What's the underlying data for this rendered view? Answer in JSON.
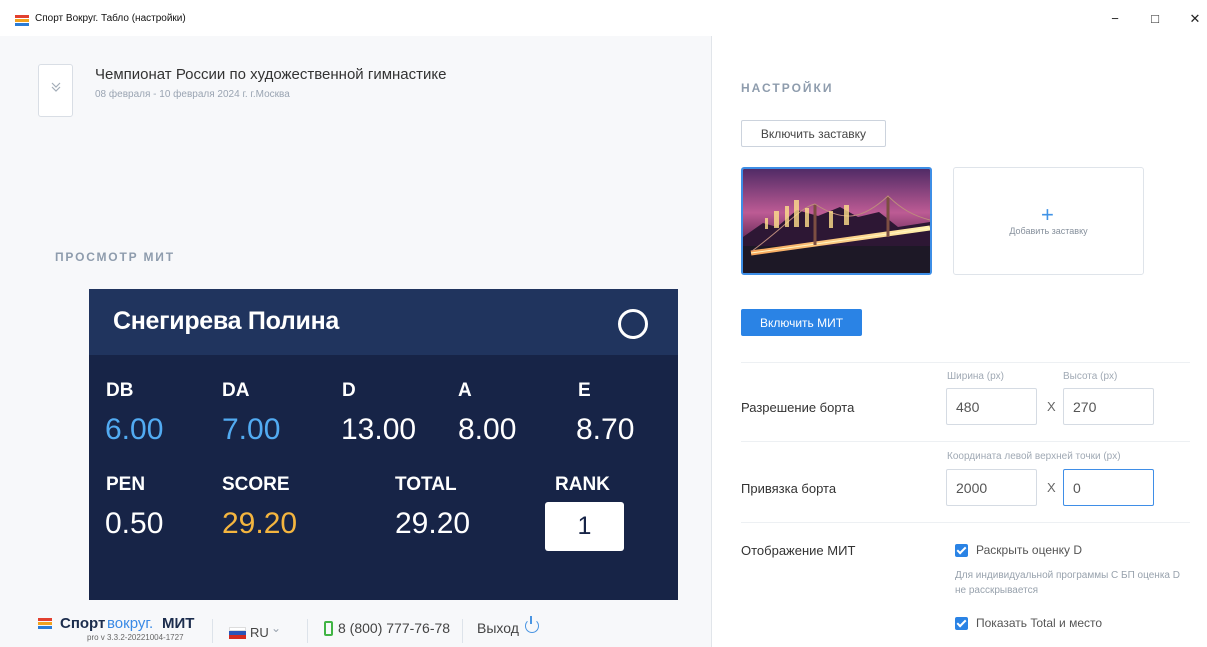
{
  "window": {
    "title": "Спорт Вокруг. Табло (настройки)",
    "minimize_glyph": "−",
    "maximize_glyph": "□",
    "close_glyph": "✕"
  },
  "event": {
    "title": "Чемпионат России по художественной гимнастике",
    "date_location": "08 февраля - 10 февраля 2024 г. г.Москва",
    "toggle_icon": "chevron-down-icon"
  },
  "preview": {
    "section_title": "ПРОСМОТР МИТ",
    "athlete": "Снегирева Полина",
    "scores": {
      "db_label": "DB",
      "db_value": "6.00",
      "da_label": "DA",
      "da_value": "7.00",
      "d_label": "D",
      "d_value": "13.00",
      "a_label": "A",
      "a_value": "8.00",
      "e_label": "E",
      "e_value": "8.70",
      "pen_label": "PEN",
      "pen_value": "0.50",
      "score_label": "SCORE",
      "score_value": "29.20",
      "total_label": "TOTAL",
      "total_value": "29.20",
      "rank_label": "RANK",
      "rank_value": "1"
    },
    "colors": {
      "board": "#172447",
      "header": "#20345e",
      "blue": "#52abf2",
      "yellow": "#f4b53f"
    }
  },
  "footer": {
    "brand_sport": "Спорт",
    "brand_around": "вокруг.",
    "brand_mit": "МИТ",
    "version": "pro v 3.3.2-20221004-1727",
    "language": "RU",
    "phone": "8 (800) 777-76-78",
    "logout": "Выход"
  },
  "settings": {
    "title": "НАСТРОЙКИ",
    "screensaver_button": "Включить заставку",
    "add_screensaver": "Добавить заставку",
    "mit_button": "Включить МИТ",
    "resolution": {
      "label": "Разрешение борта",
      "width_hint": "Ширина (px)",
      "height_hint": "Высота (px)",
      "width_value": "480",
      "height_value": "270",
      "separator": "X"
    },
    "binding": {
      "label": "Привязка борта",
      "hint": "Координата левой верхней точки (px)",
      "x_value": "2000",
      "y_value": "0",
      "separator": "X"
    },
    "display": {
      "label": "Отображение МИТ",
      "reveal_d": "Раскрыть оценку D",
      "reveal_d_checked": true,
      "note": "Для индивидуальной программы С БП оценка D не расскрывается",
      "show_total": "Показать Total и место",
      "show_total_checked": true
    },
    "accent": "#2a83e5"
  }
}
